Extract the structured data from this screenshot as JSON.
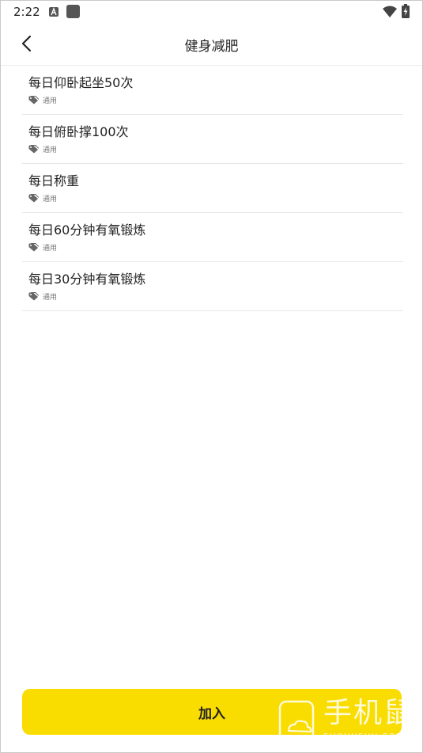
{
  "status_bar": {
    "time": "2:22",
    "icons": [
      "a-notification-icon",
      "square-notification-icon",
      "wifi-icon",
      "battery-charging-icon"
    ]
  },
  "header": {
    "title": "健身减肥",
    "back_icon": "chevron-left-icon"
  },
  "tasks": [
    {
      "title": "每日仰卧起坐50次",
      "tag": "通用"
    },
    {
      "title": "每日俯卧撑100次",
      "tag": "通用"
    },
    {
      "title": "每日称重",
      "tag": "通用"
    },
    {
      "title": "每日60分钟有氧锻炼",
      "tag": "通用"
    },
    {
      "title": "每日30分钟有氧锻炼",
      "tag": "通用"
    }
  ],
  "footer": {
    "join_label": "加入"
  },
  "watermark": {
    "text": "手机鼠",
    "sub": "SHOUJISHU.COM"
  },
  "colors": {
    "accent": "#f9dc00",
    "text": "#222222",
    "muted": "#777777",
    "divider": "#e6e6e6"
  }
}
